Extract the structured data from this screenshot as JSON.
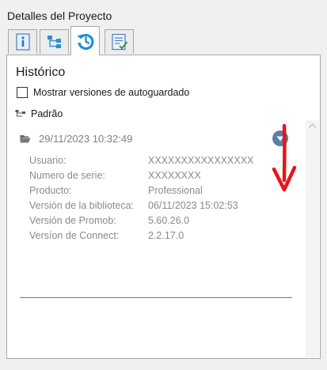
{
  "panel": {
    "title": "Detalles del Proyecto"
  },
  "tabs": [
    {
      "id": "info",
      "icon": "info-icon",
      "active": false
    },
    {
      "id": "structure",
      "icon": "tree-structure-icon",
      "active": false
    },
    {
      "id": "history",
      "icon": "history-icon",
      "active": true
    },
    {
      "id": "checklist",
      "icon": "checklist-icon",
      "active": false
    }
  ],
  "history": {
    "heading": "Histórico",
    "autosave_label": "Mostrar versiones de autoguardado",
    "autosave_checked": false,
    "branch_label": "Padrão",
    "version": {
      "date": "29/11/2023 10:32:49",
      "fields": [
        {
          "label": "Usuario:",
          "value": "XXXXXXXXXXXXXXXX"
        },
        {
          "label": "Numero de serie:",
          "value": "XXXXXXXX"
        },
        {
          "label": "Producto:",
          "value": "Professional"
        },
        {
          "label": "Versión de la biblioteca:",
          "value": "06/11/2023 15:02:53"
        },
        {
          "label": "Versión de Promob:",
          "value": "5.60.26.0"
        },
        {
          "label": "Versíon de Connect:",
          "value": "2.2.17.0"
        }
      ]
    }
  },
  "colors": {
    "accent": "#5b7fa6",
    "annotation": "#e8141c",
    "muted_text": "#8a8a8a"
  }
}
